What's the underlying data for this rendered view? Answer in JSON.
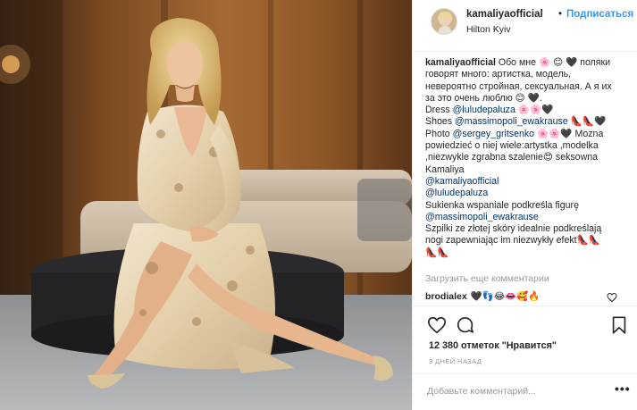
{
  "header": {
    "username": "kamaliyaofficial",
    "separator": "•",
    "follow_label": "Подписаться",
    "location": "Hilton Kyiv"
  },
  "caption": {
    "username": "kamaliyaofficial",
    "lines": {
      "l1": " Обо мне 🌸 😊 🖤 поляки",
      "l2": "говорят много: артистка, модель,",
      "l3": "невероятно стройная, сексуальная. А я их",
      "l4": "за это очень люблю 😊 🖤.",
      "l5_pre": "Dress ",
      "l5_mention": "@luludepaluza",
      "l5_post": " 🌸🌸🖤",
      "l6_pre": "Shoes ",
      "l6_mention": "@massimopoli_ewakrause",
      "l6_post": " 👠👠🖤",
      "l7_pre": "Photo ",
      "l7_mention": "@sergey_gritsenko",
      "l7_post": " 🌸🌸🖤 Mozna",
      "l8": "powiedzieć o niej wiele:artystka ,modelka",
      "l9": ",niezwykle zgrabna szalenie😍 seksowna",
      "l10": "Kamaliya",
      "l11_mention": "@kamaliyaofficial",
      "l12_mention": "@luludepaluza",
      "l13": "Sukienka wspaniale podkreśla figurę",
      "l14_mention": "@massimopoli_ewakrause",
      "l15": "Szpilki ze złotej skóry idealnie podkreślają",
      "l16": "nogi zapewniając im niezwykły efekt👠👠",
      "l17": "👠👠"
    },
    "load_more": "Загрузить еще комментарии"
  },
  "comments": [
    {
      "username": "brodialex",
      "text": "🖤👣😂👄🥰🔥"
    }
  ],
  "actions": {
    "likes": "12 380 отметок \"Нравится\"",
    "time": "3 ДНЕЙ НАЗАД"
  },
  "comment_box": {
    "placeholder": "Добавьте комментарий...",
    "more": "•••"
  },
  "icons": {
    "like": "heart-icon",
    "comment": "comment-icon",
    "save": "bookmark-icon",
    "comment_like": "small-heart-icon"
  },
  "colors": {
    "accent": "#3897f0",
    "mention": "#003569",
    "muted": "#999999",
    "text": "#262626"
  }
}
